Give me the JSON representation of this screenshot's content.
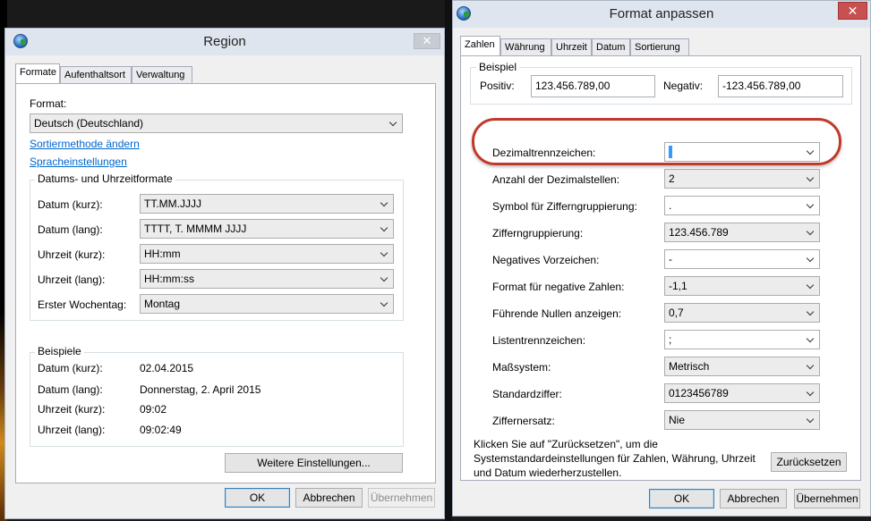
{
  "region": {
    "title": "Region",
    "tabs": [
      "Formate",
      "Aufenthaltsort",
      "Verwaltung"
    ],
    "format_label": "Format:",
    "format_value": "Deutsch (Deutschland)",
    "link_sort": "Sortiermethode ändern",
    "link_lang": "Spracheinstellungen",
    "datetime_group": "Datums- und Uhrzeitformate",
    "rows": [
      {
        "label": "Datum (kurz):",
        "value": "TT.MM.JJJJ"
      },
      {
        "label": "Datum (lang):",
        "value": "TTTT, T. MMMM JJJJ"
      },
      {
        "label": "Uhrzeit (kurz):",
        "value": "HH:mm"
      },
      {
        "label": "Uhrzeit (lang):",
        "value": "HH:mm:ss"
      },
      {
        "label": "Erster Wochentag:",
        "value": "Montag"
      }
    ],
    "examples_group": "Beispiele",
    "examples": [
      {
        "label": "Datum (kurz):",
        "value": "02.04.2015"
      },
      {
        "label": "Datum (lang):",
        "value": "Donnerstag, 2. April 2015"
      },
      {
        "label": "Uhrzeit (kurz):",
        "value": "09:02"
      },
      {
        "label": "Uhrzeit (lang):",
        "value": "09:02:49"
      }
    ],
    "more_settings": "Weitere Einstellungen...",
    "ok": "OK",
    "cancel": "Abbrechen",
    "apply": "Übernehmen"
  },
  "format": {
    "title": "Format anpassen",
    "tabs": [
      "Zahlen",
      "Währung",
      "Uhrzeit",
      "Datum",
      "Sortierung"
    ],
    "example_group": "Beispiel",
    "positive_label": "Positiv:",
    "positive_value": "123.456.789,00",
    "negative_label": "Negativ:",
    "negative_value": "-123.456.789,00",
    "decimal_label": "Dezimaltrennzeichen:",
    "decimal_value": ",",
    "rows": [
      {
        "label": "Anzahl der Dezimalstellen:",
        "value": "2"
      },
      {
        "label": "Symbol für Zifferngruppierung:",
        "value": "."
      },
      {
        "label": "Zifferngruppierung:",
        "value": "123.456.789"
      },
      {
        "label": "Negatives Vorzeichen:",
        "value": "-"
      },
      {
        "label": "Format für negative Zahlen:",
        "value": "-1,1"
      },
      {
        "label": "Führende Nullen anzeigen:",
        "value": "0,7"
      },
      {
        "label": "Listentrennzeichen:",
        "value": ";"
      },
      {
        "label": "Maßsystem:",
        "value": "Metrisch"
      },
      {
        "label": "Standardziffer:",
        "value": "0123456789"
      },
      {
        "label": "Ziffernersatz:",
        "value": "Nie"
      }
    ],
    "reset_text_1": "Klicken Sie auf \"Zurücksetzen\", um die",
    "reset_text_2": "Systemstandardeinstellungen für Zahlen, Währung, Uhrzeit",
    "reset_text_3": "und Datum wiederherzustellen.",
    "reset_button": "Zurücksetzen",
    "ok": "OK",
    "cancel": "Abbrechen",
    "apply": "Übernehmen"
  },
  "colors": {
    "highlight": "#c0392b",
    "link": "#0066cc",
    "default_button_border": "#3c7fb1"
  }
}
